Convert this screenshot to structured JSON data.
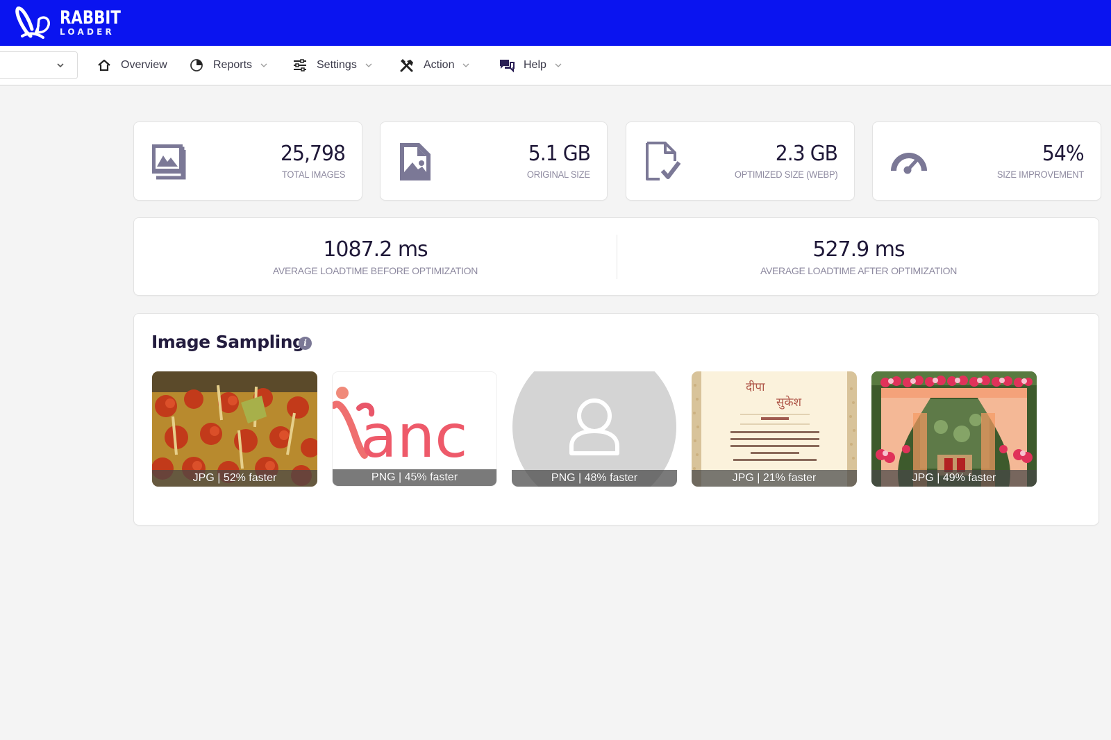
{
  "brand": {
    "name_line1": "RABBIT",
    "name_line2": "LOADER",
    "bar_color": "#0a14f0"
  },
  "nav": {
    "site_select": {
      "value": ""
    },
    "items": [
      {
        "label": "Overview",
        "icon": "home-icon",
        "has_dropdown": false
      },
      {
        "label": "Reports",
        "icon": "pie-chart-icon",
        "has_dropdown": true
      },
      {
        "label": "Settings",
        "icon": "sliders-icon",
        "has_dropdown": true
      },
      {
        "label": "Action",
        "icon": "tools-icon",
        "has_dropdown": true
      },
      {
        "label": "Help",
        "icon": "chat-icon",
        "has_dropdown": true
      }
    ]
  },
  "stats": [
    {
      "value": "25,798",
      "label": "TOTAL IMAGES",
      "icon": "images-icon"
    },
    {
      "value": "5.1 GB",
      "label": "ORIGINAL SIZE",
      "icon": "image-file-icon"
    },
    {
      "value": "2.3 GB",
      "label": "OPTIMIZED SIZE (WEBP)",
      "icon": "file-check-icon"
    },
    {
      "value": "54%",
      "label": "SIZE IMPROVEMENT",
      "icon": "gauge-icon"
    }
  ],
  "loadtime": {
    "before": {
      "value": "1087.2 ms",
      "label": "AVERAGE LOADTIME BEFORE OPTIMIZATION"
    },
    "after": {
      "value": "527.9 ms",
      "label": "AVERAGE LOADTIME AFTER OPTIMIZATION"
    }
  },
  "sampling": {
    "title": "Image Sampling",
    "info_icon": "i",
    "images": [
      {
        "caption": "JPG | 52% faster",
        "subject": "food-appetizers"
      },
      {
        "caption": "PNG | 45% faster",
        "subject": "pink-logo-text"
      },
      {
        "caption": "PNG | 48% faster",
        "subject": "default-avatar"
      },
      {
        "caption": "JPG | 21% faster",
        "subject": "wedding-invitation",
        "text_line1": "दीपा",
        "text_line2": "सुकेश"
      },
      {
        "caption": "JPG | 49% faster",
        "subject": "floral-mandap"
      }
    ]
  },
  "colors": {
    "icon_purple": "#7b7896",
    "text_dark": "#1f1838",
    "text_muted": "#8e8aa0",
    "page_bg": "#f4f4f4"
  }
}
